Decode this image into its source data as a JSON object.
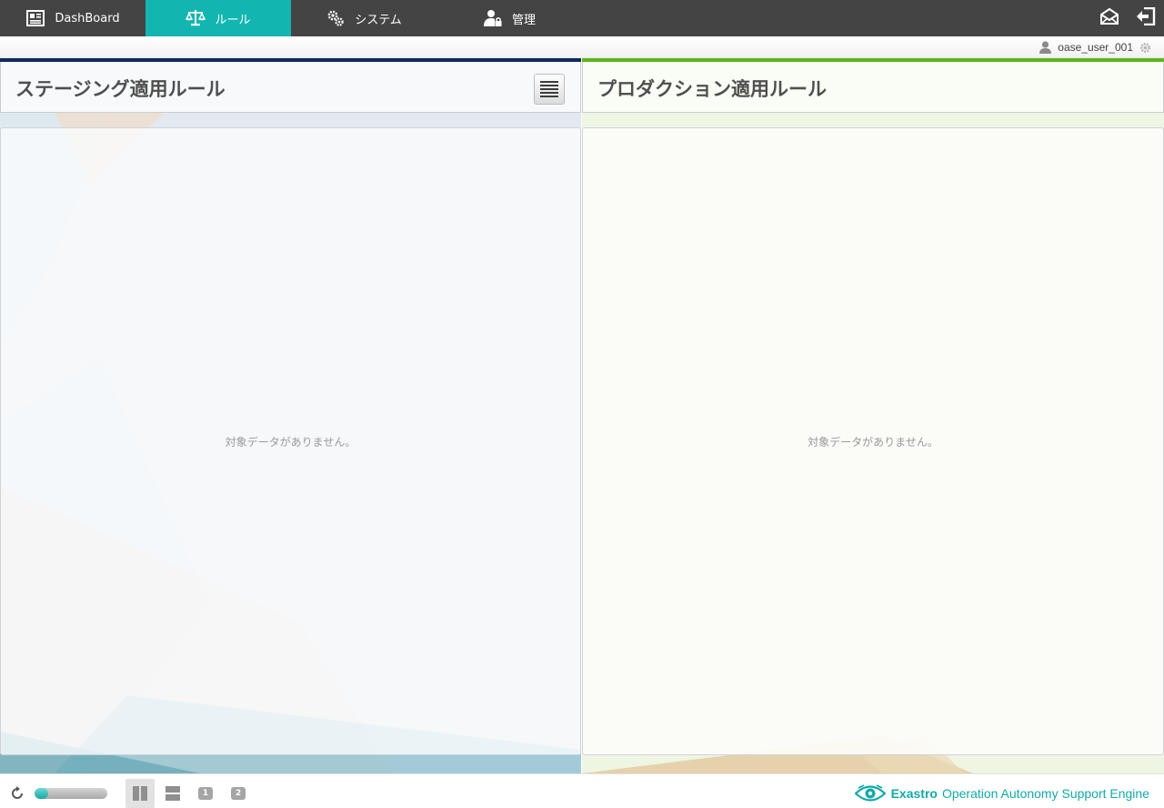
{
  "nav": {
    "tabs": [
      {
        "label": "DashBoard",
        "icon": "dashboard-icon"
      },
      {
        "label": "ルール",
        "icon": "scale-icon"
      },
      {
        "label": "システム",
        "icon": "gears-icon"
      },
      {
        "label": "管理",
        "icon": "user-lock-icon"
      }
    ],
    "active_tab": "ルール",
    "tools": [
      "mail-icon",
      "logout-icon"
    ]
  },
  "user": {
    "name": "oase_user_001"
  },
  "panels": {
    "staging": {
      "title": "ステージング適用ルール",
      "empty_message": "対象データがありません。",
      "accent": "#0e2a5c"
    },
    "production": {
      "title": "プロダクション適用ルール",
      "empty_message": "対象データがありません。",
      "accent": "#5fb41c"
    }
  },
  "footer": {
    "layout_buttons": [
      "two-column",
      "two-row"
    ],
    "selected_layout": "two-column",
    "pane_numbers": [
      "1",
      "2"
    ],
    "brand_name": "Exastro",
    "brand_tagline": "Operation Autonomy Support Engine"
  },
  "colors": {
    "nav_bg": "#444444",
    "active_tab": "#13b5b1",
    "brand": "#13a9a9"
  }
}
